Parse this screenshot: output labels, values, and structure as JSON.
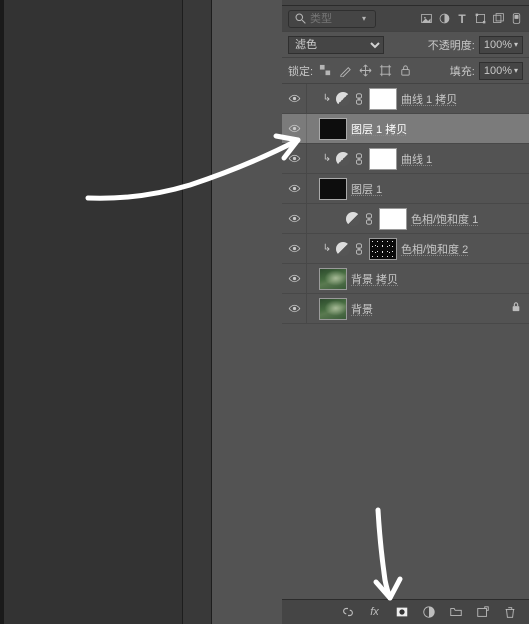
{
  "filter": {
    "placeholder": "类型"
  },
  "blend": {
    "mode": "滤色",
    "opacity_label": "不透明度:",
    "opacity_value": "100%",
    "fill_label": "填充:",
    "fill_value": "100%",
    "lock_label": "锁定:"
  },
  "layers": [
    {
      "name": "曲线 1 拷贝",
      "thumb": "white",
      "clip": true,
      "adj": true,
      "link": true,
      "selected": false,
      "indent": 14
    },
    {
      "name": "图层 1 拷贝",
      "thumb": "black",
      "clip": false,
      "adj": false,
      "link": false,
      "selected": true,
      "indent": 8
    },
    {
      "name": "曲线 1",
      "thumb": "white",
      "clip": true,
      "adj": true,
      "link": true,
      "selected": false,
      "indent": 14
    },
    {
      "name": "图层 1",
      "thumb": "black",
      "clip": false,
      "adj": false,
      "link": false,
      "selected": false,
      "indent": 8
    },
    {
      "name": "色相/饱和度 1",
      "thumb": "white",
      "clip": false,
      "adj": true,
      "link": true,
      "selected": false,
      "indent": 36
    },
    {
      "name": "色相/饱和度 2",
      "thumb": "speckle",
      "clip": true,
      "adj": true,
      "link": true,
      "selected": false,
      "indent": 14
    },
    {
      "name": "背景 拷贝",
      "thumb": "photo",
      "clip": false,
      "adj": false,
      "link": false,
      "selected": false,
      "indent": 8
    },
    {
      "name": "背景",
      "thumb": "photo",
      "clip": false,
      "adj": false,
      "link": false,
      "selected": false,
      "indent": 8,
      "locked": true
    }
  ]
}
